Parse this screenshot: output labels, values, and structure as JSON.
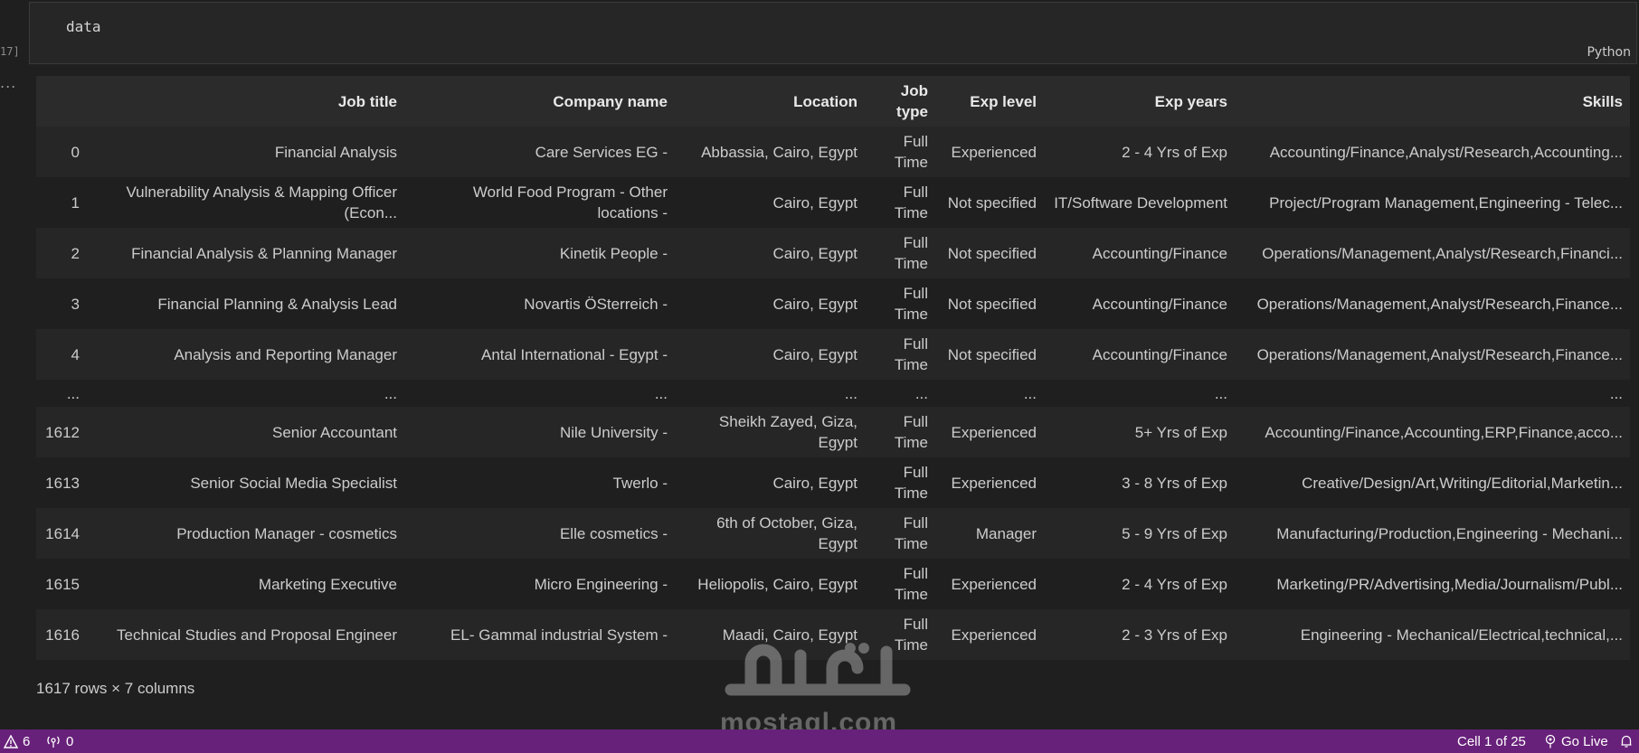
{
  "cell": {
    "execution_count": "17]",
    "code": "data",
    "language": "Python",
    "output_marker": "..."
  },
  "table": {
    "columns": [
      "",
      "Job title",
      "Company name",
      "Location",
      "Job type",
      "Exp level",
      "Exp years",
      "Skills"
    ],
    "rows": [
      [
        "0",
        "Financial Analysis",
        "Care Services EG -",
        "Abbassia, Cairo, Egypt",
        "Full Time",
        "Experienced",
        "2 - 4 Yrs of Exp",
        "Accounting/Finance,Analyst/Research,Accounting..."
      ],
      [
        "1",
        "Vulnerability Analysis & Mapping Officer (Econ...",
        "World Food Program - Other locations -",
        "Cairo, Egypt",
        "Full Time",
        "Not specified",
        "IT/Software Development",
        "Project/Program Management,Engineering - Telec..."
      ],
      [
        "2",
        "Financial Analysis & Planning Manager",
        "Kinetik People -",
        "Cairo, Egypt",
        "Full Time",
        "Not specified",
        "Accounting/Finance",
        "Operations/Management,Analyst/Research,Financi..."
      ],
      [
        "3",
        "Financial Planning & Analysis Lead",
        "Novartis ÖSterreich -",
        "Cairo, Egypt",
        "Full Time",
        "Not specified",
        "Accounting/Finance",
        "Operations/Management,Analyst/Research,Finance..."
      ],
      [
        "4",
        "Analysis and Reporting Manager",
        "Antal International - Egypt -",
        "Cairo, Egypt",
        "Full Time",
        "Not specified",
        "Accounting/Finance",
        "Operations/Management,Analyst/Research,Finance..."
      ],
      [
        "...",
        "...",
        "...",
        "...",
        "...",
        "...",
        "...",
        "..."
      ],
      [
        "1612",
        "Senior Accountant",
        "Nile University -",
        "Sheikh Zayed, Giza, Egypt",
        "Full Time",
        "Experienced",
        "5+ Yrs of Exp",
        "Accounting/Finance,Accounting,ERP,Finance,acco..."
      ],
      [
        "1613",
        "Senior Social Media Specialist",
        "Twerlo -",
        "Cairo, Egypt",
        "Full Time",
        "Experienced",
        "3 - 8 Yrs of Exp",
        "Creative/Design/Art,Writing/Editorial,Marketin..."
      ],
      [
        "1614",
        "Production Manager - cosmetics",
        "Elle cosmetics -",
        "6th of October, Giza, Egypt",
        "Full Time",
        "Manager",
        "5 - 9 Yrs of Exp",
        "Manufacturing/Production,Engineering - Mechani..."
      ],
      [
        "1615",
        "Marketing Executive",
        "Micro Engineering -",
        "Heliopolis, Cairo, Egypt",
        "Full Time",
        "Experienced",
        "2 - 4 Yrs of Exp",
        "Marketing/PR/Advertising,Media/Journalism/Publ..."
      ],
      [
        "1616",
        "Technical Studies and Proposal Engineer",
        "EL- Gammal industrial System -",
        "Maadi, Cairo, Egypt",
        "Full Time",
        "Experienced",
        "2 - 3 Yrs of Exp",
        "Engineering - Mechanical/Electrical,technical,..."
      ]
    ],
    "shape": "1617 rows × 7 columns"
  },
  "watermark": {
    "text": "mostaql.com",
    "arabic": "مستقل"
  },
  "statusbar": {
    "problems_count": "6",
    "ports_count": "0",
    "cell_position": "Cell 1 of 25",
    "go_live": "Go Live",
    "bg_color": "#68217a"
  }
}
